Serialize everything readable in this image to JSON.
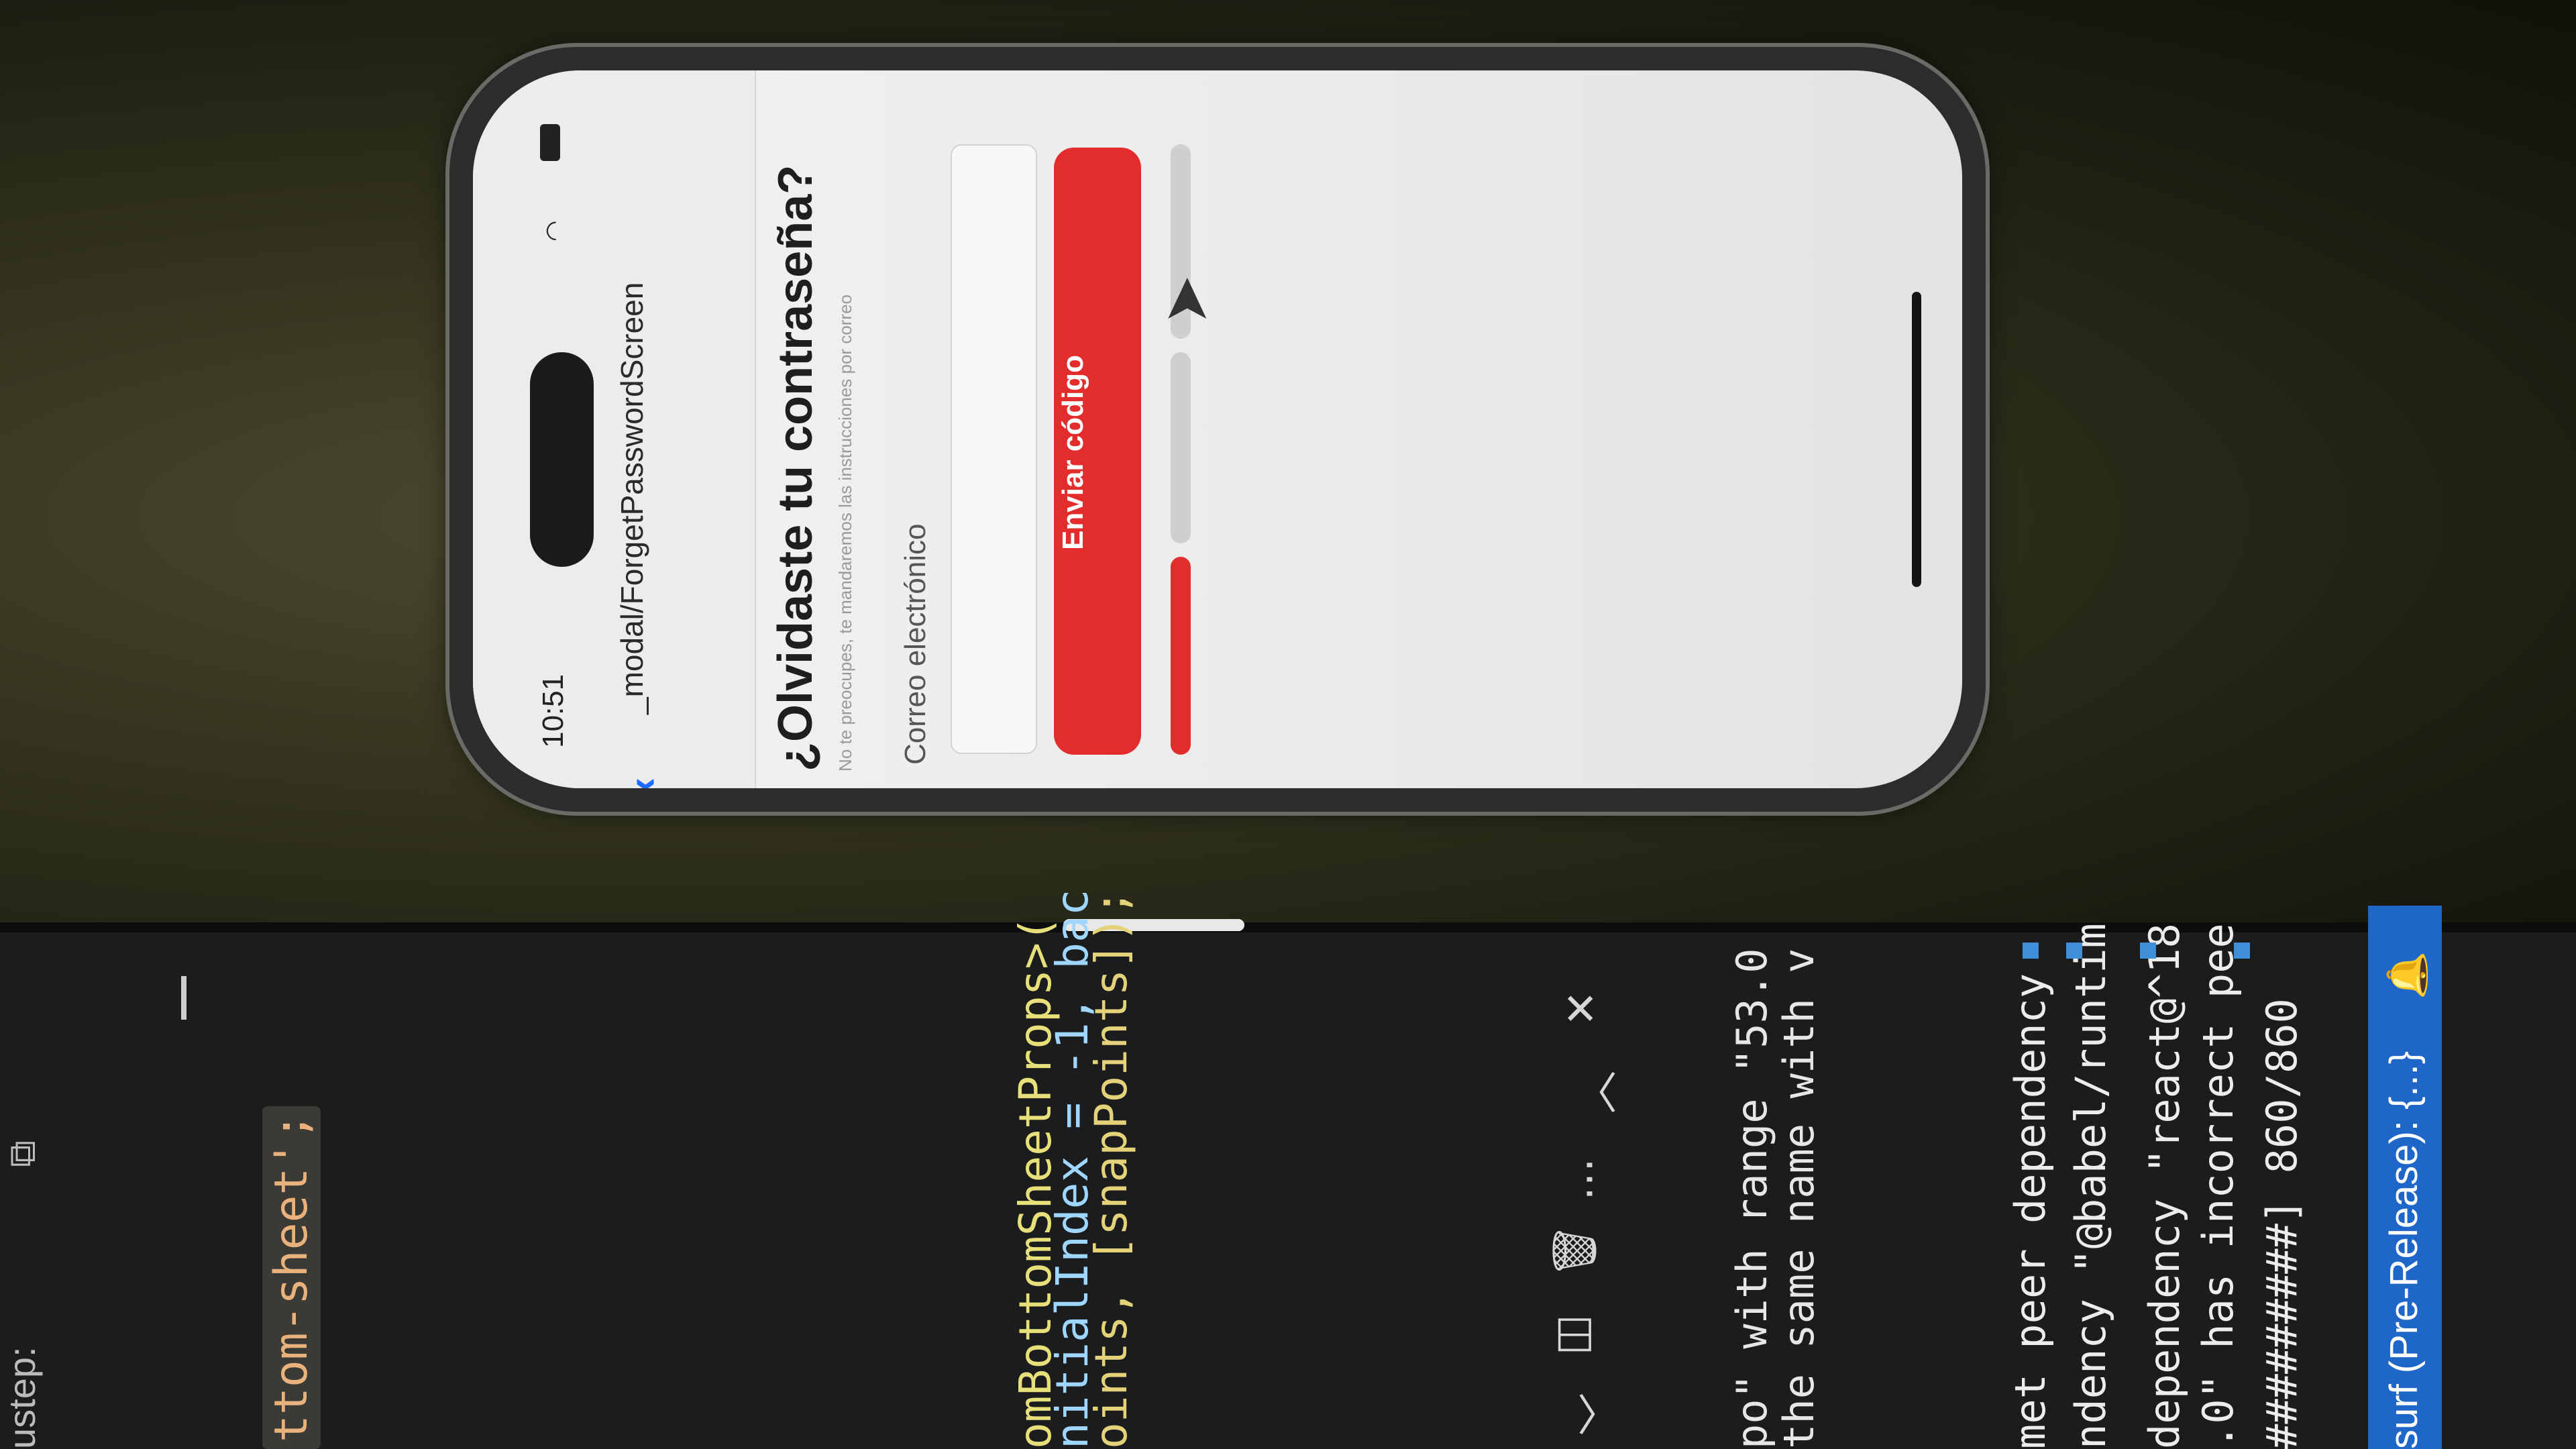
{
  "editor": {
    "header_text": "ustep: ",
    "code_fragment_prefix": "",
    "code_fragment_string": "ttom-sheet';",
    "code_lines": [
      "omBottomSheetProps>(",
      "nitialIndex = -1, bac",
      "oints, [snapPoints]);"
    ]
  },
  "terminal": {
    "output_lines": [
      "po\" with range \"53.0",
      "the same name with v"
    ],
    "log_lines": [
      "met peer dependency",
      "ndency \"@babel/runtim",
      "dependency \"react@^18",
      ".0\" has incorrect pee",
      "#########] 860/860"
    ],
    "toolbar_icons": [
      "close-icon",
      "chevron-up-icon",
      "more-icon",
      "trash-icon",
      "split-icon",
      "chevron-down-icon"
    ]
  },
  "statusbar": {
    "text": "surf (Pre-Release): {...}",
    "color": "#1f66c9"
  },
  "phone": {
    "time": "10:51",
    "nav_title": "_modal/ForgetPasswordScreen",
    "heading": "¿Olvidaste tu contraseña?",
    "subtext": "No te preocupes, te mandaremos las instrucciones por correo",
    "email_label": "Correo electrónico",
    "email_value": "",
    "submit_label": "Enviar código",
    "accent_color": "#e32c2c",
    "progress_steps_total": 3,
    "progress_steps_completed": 1
  }
}
